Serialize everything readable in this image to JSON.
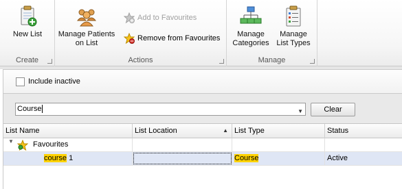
{
  "ribbon": {
    "groups": {
      "create": {
        "label": "Create",
        "new_list": {
          "label": "New List",
          "icon": "new-list-icon"
        }
      },
      "actions": {
        "label": "Actions",
        "manage_patients": {
          "label_line1": "Manage Patients",
          "label_line2": "on List",
          "icon": "people-icon"
        },
        "add_favourites": {
          "label": "Add to Favourites",
          "icon": "star-add-icon",
          "enabled": false
        },
        "remove_favourites": {
          "label": "Remove from Favourites",
          "icon": "star-remove-icon",
          "enabled": true
        }
      },
      "manage": {
        "label": "Manage",
        "manage_categories": {
          "label_line1": "Manage",
          "label_line2": "Categories",
          "icon": "hierarchy-icon"
        },
        "manage_list_types": {
          "label_line1": "Manage",
          "label_line2": "List Types",
          "icon": "clipboard-list-icon"
        }
      }
    }
  },
  "options": {
    "include_inactive_label": "Include inactive",
    "include_inactive_checked": false
  },
  "search": {
    "value": "Course",
    "clear_label": "Clear"
  },
  "grid": {
    "columns": [
      "List Name",
      "List Location",
      "List Type",
      "Status"
    ],
    "sorted_column": "List Location",
    "groups": [
      {
        "name": "Favourites",
        "rows": [
          {
            "list_name_match": "course",
            "list_name_rest": " 1",
            "list_location": "",
            "list_type": "Course",
            "status": "Active"
          }
        ]
      }
    ]
  },
  "colors": {
    "highlight": "#ffd200",
    "selected_row": "#dfe6f5",
    "accent_blue": "#3b7dd8"
  }
}
